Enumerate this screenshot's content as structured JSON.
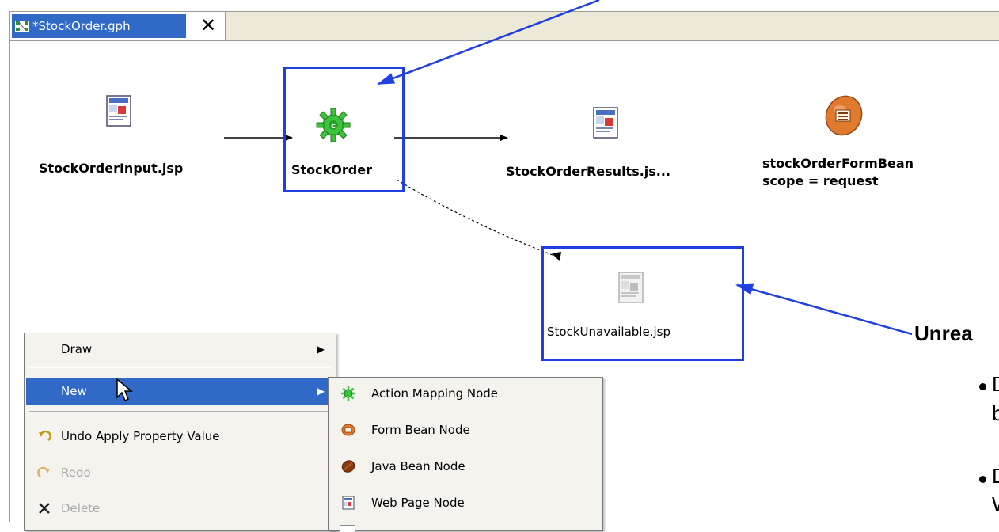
{
  "editor": {
    "tab_title": "*StockOrder.gph",
    "tab_close_glyph": "✕"
  },
  "nodes": {
    "input_jsp": {
      "label": "StockOrderInput.jsp",
      "icon": "web-page-icon"
    },
    "action": {
      "label": "StockOrder",
      "icon": "action-mapping-gear-icon"
    },
    "results_jsp": {
      "label": "StockOrderResults.js...",
      "icon": "web-page-icon"
    },
    "form_bean": {
      "label_line1": "stockOrderFormBean",
      "label_line2": "scope = request",
      "icon": "form-bean-icon"
    },
    "unavailable_jsp": {
      "label": "StockUnavailable.jsp",
      "icon": "unrealized-web-page-icon"
    }
  },
  "context_menu": {
    "items": [
      {
        "label": "Draw",
        "has_submenu": true
      },
      {
        "label": "New",
        "has_submenu": true,
        "selected": true
      },
      {
        "label": "Undo Apply Property Value",
        "icon": "undo-icon"
      },
      {
        "label": "Redo",
        "icon": "redo-icon",
        "disabled": true
      },
      {
        "label": "Delete",
        "icon": "delete-icon",
        "disabled": true
      }
    ]
  },
  "new_submenu": {
    "items": [
      {
        "label": "Action Mapping Node",
        "icon": "action-mapping-icon"
      },
      {
        "label": "Form Bean Node",
        "icon": "form-bean-icon"
      },
      {
        "label": "Java Bean Node",
        "icon": "java-bean-icon"
      },
      {
        "label": "Web Page Node",
        "icon": "web-page-icon"
      }
    ]
  },
  "annotation": {
    "title_partial": "Unrea",
    "bullet1_line1": "D",
    "bullet1_line2": "b",
    "bullet2_line1": "D",
    "bullet2_line2": "W"
  },
  "colors": {
    "selection_blue": "#1f3fe0",
    "menu_highlight": "#3169c6",
    "gear_green": "#3cc43c",
    "form_bean_orange": "#e07a2e"
  }
}
